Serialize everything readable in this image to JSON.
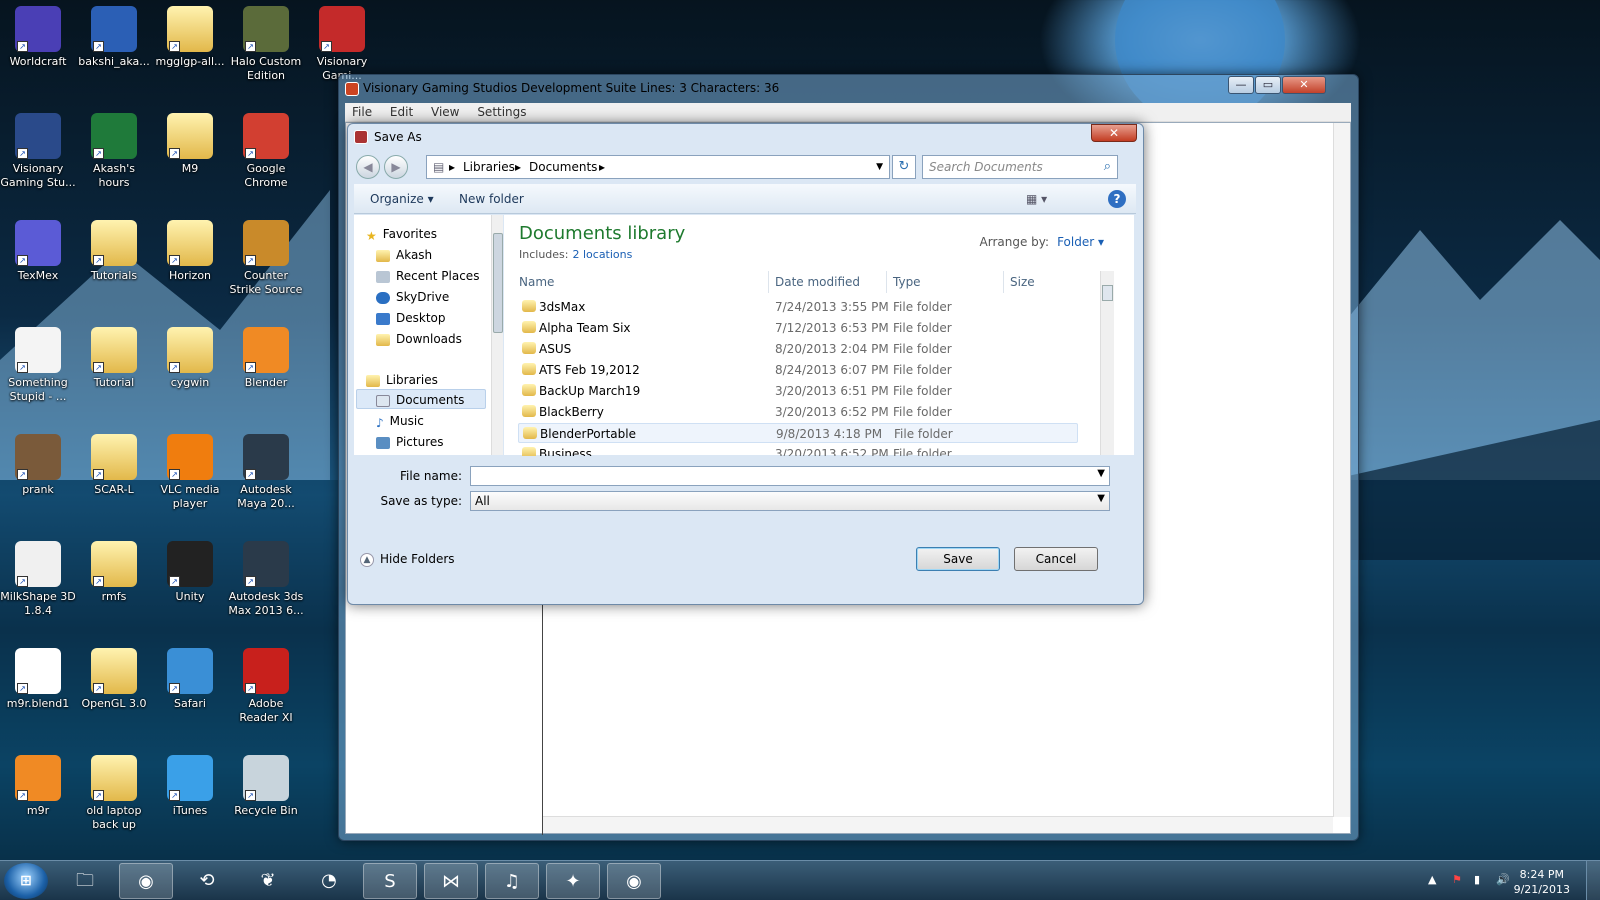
{
  "desktop": {
    "icons": [
      {
        "label": "Worldcraft",
        "icon": "worldcraft-icon",
        "color": "#4a3fb5"
      },
      {
        "label": "bakshi_aka...",
        "icon": "word-doc-icon",
        "color": "#2b5fb5"
      },
      {
        "label": "mgglgp-all...",
        "icon": "folder-icon",
        "color": "#e2b84a"
      },
      {
        "label": "Halo Custom Edition",
        "icon": "halo-icon",
        "color": "#5b6b3a"
      },
      {
        "label": "Visionary Gami...",
        "icon": "visionary-eye-icon",
        "color": "#c42a2a"
      },
      {
        "label": "Visionary Gaming Stu...",
        "icon": "visionary-studio-icon",
        "color": "#2a4a8a"
      },
      {
        "label": "Akash's hours",
        "icon": "excel-icon",
        "color": "#1f7a3a"
      },
      {
        "label": "M9",
        "icon": "folder-icon",
        "color": "#e2b84a"
      },
      {
        "label": "Google Chrome",
        "icon": "chrome-icon",
        "color": "#d23f31"
      },
      {
        "label": "TexMex",
        "icon": "texmex-icon",
        "color": "#5b5bd6"
      },
      {
        "label": "Tutorials",
        "icon": "folder-icon",
        "color": "#e2b84a"
      },
      {
        "label": "Horizon",
        "icon": "folder-icon",
        "color": "#e2b84a"
      },
      {
        "label": "Counter Strike Source",
        "icon": "counter-strike-icon",
        "color": "#c98a2a"
      },
      {
        "label": "Something Stupid - ...",
        "icon": "mp3-icon",
        "color": "#f4f4f4"
      },
      {
        "label": "Tutorial",
        "icon": "folder-icon",
        "color": "#e2b84a"
      },
      {
        "label": "cygwin",
        "icon": "folder-icon",
        "color": "#e2b84a"
      },
      {
        "label": "Blender",
        "icon": "blender-icon",
        "color": "#f08a24"
      },
      {
        "label": "prank",
        "icon": "prank-icon",
        "color": "#7a5a3a"
      },
      {
        "label": "SCAR-L",
        "icon": "folder-icon",
        "color": "#e2b84a"
      },
      {
        "label": "VLC media player",
        "icon": "vlc-icon",
        "color": "#f07d0e"
      },
      {
        "label": "Autodesk Maya 20...",
        "icon": "maya-icon",
        "color": "#2a3a4a"
      },
      {
        "label": "MilkShape 3D 1.8.4",
        "icon": "milkshape-icon",
        "color": "#f0f0f0"
      },
      {
        "label": "rmfs",
        "icon": "folder-icon",
        "color": "#e2b84a"
      },
      {
        "label": "Unity",
        "icon": "unity-icon",
        "color": "#222222"
      },
      {
        "label": "Autodesk 3ds Max 2013 6...",
        "icon": "3dsmax-icon",
        "color": "#2a3a4a"
      },
      {
        "label": "m9r.blend1",
        "icon": "file-icon",
        "color": "#ffffff"
      },
      {
        "label": "OpenGL 3.0",
        "icon": "folder-icon",
        "color": "#e2b84a"
      },
      {
        "label": "Safari",
        "icon": "safari-icon",
        "color": "#3a8fd6"
      },
      {
        "label": "Adobe Reader XI",
        "icon": "adobe-reader-icon",
        "color": "#c8201c"
      },
      {
        "label": "m9r",
        "icon": "blender-icon",
        "color": "#f08a24"
      },
      {
        "label": "old laptop back up",
        "icon": "folder-icon",
        "color": "#e2b84a"
      },
      {
        "label": "iTunes",
        "icon": "itunes-icon",
        "color": "#3aa0e8"
      },
      {
        "label": "Recycle Bin",
        "icon": "recycle-bin-icon",
        "color": "#c8d4dc"
      }
    ]
  },
  "mainWindow": {
    "title": "Visionary Gaming Studios Development Suite Lines: 3 Characters: 36",
    "menu": [
      "File",
      "Edit",
      "View",
      "Settings"
    ],
    "controls": {
      "minimize": "—",
      "maximize": "▭",
      "close": "✕"
    }
  },
  "dialog": {
    "title": "Save As",
    "close": "✕",
    "back": "◀",
    "forward": "▶",
    "breadcrumb": [
      "Libraries",
      "Documents"
    ],
    "breadcrumb_sep": "▸",
    "search_placeholder": "Search Documents",
    "toolbar": {
      "organize": "Organize ▾",
      "new_folder": "New folder",
      "help": "?"
    },
    "nav": {
      "favorites_header": "Favorites",
      "favorites": [
        "Akash",
        "Recent Places",
        "SkyDrive",
        "Desktop",
        "Downloads"
      ],
      "libraries_header": "Libraries",
      "libraries": [
        "Documents",
        "Music",
        "Pictures"
      ],
      "selected": "Documents"
    },
    "library": {
      "title": "Documents library",
      "includes_label": "Includes:",
      "includes_link": "2 locations",
      "arrange_label": "Arrange by:",
      "arrange_value": "Folder ▾"
    },
    "columns": [
      "Name",
      "Date modified",
      "Type",
      "Size"
    ],
    "files": [
      {
        "name": "3dsMax",
        "date": "7/24/2013 3:55 PM",
        "type": "File folder"
      },
      {
        "name": "Alpha Team Six",
        "date": "7/12/2013 6:53 PM",
        "type": "File folder"
      },
      {
        "name": "ASUS",
        "date": "8/20/2013 2:04 PM",
        "type": "File folder"
      },
      {
        "name": "ATS Feb 19,2012",
        "date": "8/24/2013 6:07 PM",
        "type": "File folder"
      },
      {
        "name": "BackUp March19",
        "date": "3/20/2013 6:51 PM",
        "type": "File folder"
      },
      {
        "name": "BlackBerry",
        "date": "3/20/2013 6:52 PM",
        "type": "File folder"
      },
      {
        "name": "BlenderPortable",
        "date": "9/8/2013 4:18 PM",
        "type": "File folder"
      },
      {
        "name": "Business",
        "date": "3/20/2013 6:52 PM",
        "type": "File folder"
      }
    ],
    "selected_file": "BlenderPortable",
    "filename_label": "File name:",
    "filename_value": "",
    "savetype_label": "Save as type:",
    "savetype_value": "All",
    "hide_folders": "Hide Folders",
    "save": "Save",
    "cancel": "Cancel"
  },
  "taskbar": {
    "start": "⊞",
    "apps": [
      {
        "name": "explorer",
        "icon": "folder-icon",
        "glyph": "🗀",
        "active": false
      },
      {
        "name": "chrome",
        "icon": "chrome-icon",
        "glyph": "◉",
        "active": true
      },
      {
        "name": "3dsmax",
        "icon": "3dsmax-icon",
        "glyph": "⟲",
        "active": false
      },
      {
        "name": "maya",
        "icon": "maya-icon",
        "glyph": "❦",
        "active": false
      },
      {
        "name": "blender",
        "icon": "blender-icon",
        "glyph": "◔",
        "active": false
      },
      {
        "name": "skype",
        "icon": "skype-icon",
        "glyph": "S",
        "active": true
      },
      {
        "name": "visual-studio",
        "icon": "visual-studio-icon",
        "glyph": "⋈",
        "active": true
      },
      {
        "name": "itunes",
        "icon": "itunes-icon",
        "glyph": "♫",
        "active": true
      },
      {
        "name": "game",
        "icon": "game-icon",
        "glyph": "✦",
        "active": true
      },
      {
        "name": "visionary",
        "icon": "visionary-eye-icon",
        "glyph": "◉",
        "active": true
      }
    ],
    "clock_time": "8:24 PM",
    "clock_date": "9/21/2013",
    "tray": {
      "up": "▲",
      "flag": "⚑",
      "signal": "▮",
      "volume": "🔊"
    }
  },
  "colors": {
    "accent": "#1a5fb4",
    "library_title": "#1e7a2e",
    "taskbar": "#1a3449"
  }
}
